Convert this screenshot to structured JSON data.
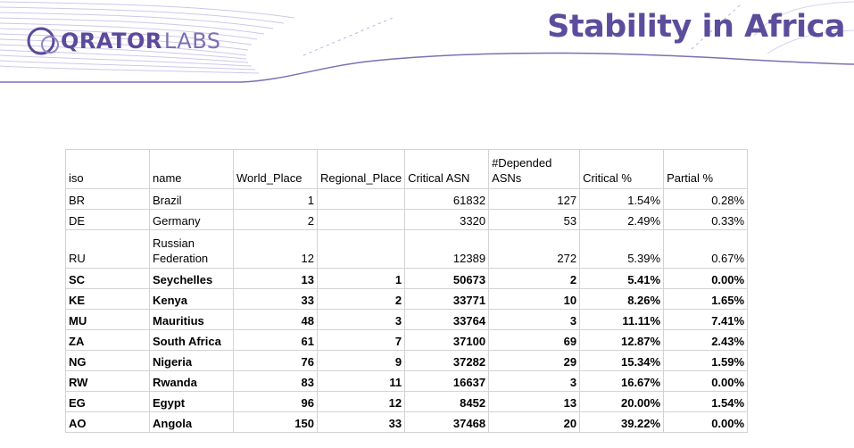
{
  "header": {
    "logo_bold": "QRATOR",
    "logo_light": "LABS",
    "title": "Stability in Africa"
  },
  "colors": {
    "brand_purple": "#5c4d9c",
    "line_lavender": "#c9c0e6",
    "grid": "#d3d3d3"
  },
  "table": {
    "columns": [
      "iso",
      "name",
      "World_Place",
      "Regional_Place",
      "Critical ASN",
      "#Depended ASNs",
      "Critical %",
      "Partial %"
    ],
    "rows": [
      {
        "iso": "BR",
        "name": "Brazil",
        "world": "1",
        "regional": "",
        "critical_asn": "61832",
        "depended": "127",
        "critical_pct": "1.54%",
        "partial_pct": "0.28%",
        "bold": false
      },
      {
        "iso": "DE",
        "name": "Germany",
        "world": "2",
        "regional": "",
        "critical_asn": "3320",
        "depended": "53",
        "critical_pct": "2.49%",
        "partial_pct": "0.33%",
        "bold": false
      },
      {
        "iso": "RU",
        "name": "Russian Federation",
        "world": "12",
        "regional": "",
        "critical_asn": "12389",
        "depended": "272",
        "critical_pct": "5.39%",
        "partial_pct": "0.67%",
        "bold": false
      },
      {
        "iso": "SC",
        "name": "Seychelles",
        "world": "13",
        "regional": "1",
        "critical_asn": "50673",
        "depended": "2",
        "critical_pct": "5.41%",
        "partial_pct": "0.00%",
        "bold": true
      },
      {
        "iso": "KE",
        "name": "Kenya",
        "world": "33",
        "regional": "2",
        "critical_asn": "33771",
        "depended": "10",
        "critical_pct": "8.26%",
        "partial_pct": "1.65%",
        "bold": true
      },
      {
        "iso": "MU",
        "name": "Mauritius",
        "world": "48",
        "regional": "3",
        "critical_asn": "33764",
        "depended": "3",
        "critical_pct": "11.11%",
        "partial_pct": "7.41%",
        "bold": true
      },
      {
        "iso": "ZA",
        "name": "South Africa",
        "world": "61",
        "regional": "7",
        "critical_asn": "37100",
        "depended": "69",
        "critical_pct": "12.87%",
        "partial_pct": "2.43%",
        "bold": true
      },
      {
        "iso": "NG",
        "name": "Nigeria",
        "world": "76",
        "regional": "9",
        "critical_asn": "37282",
        "depended": "29",
        "critical_pct": "15.34%",
        "partial_pct": "1.59%",
        "bold": true
      },
      {
        "iso": "RW",
        "name": "Rwanda",
        "world": "83",
        "regional": "11",
        "critical_asn": "16637",
        "depended": "3",
        "critical_pct": "16.67%",
        "partial_pct": "0.00%",
        "bold": true
      },
      {
        "iso": "EG",
        "name": "Egypt",
        "world": "96",
        "regional": "12",
        "critical_asn": "8452",
        "depended": "13",
        "critical_pct": "20.00%",
        "partial_pct": "1.54%",
        "bold": true
      },
      {
        "iso": "AO",
        "name": "Angola",
        "world": "150",
        "regional": "33",
        "critical_asn": "37468",
        "depended": "20",
        "critical_pct": "39.22%",
        "partial_pct": "0.00%",
        "bold": true
      }
    ]
  }
}
